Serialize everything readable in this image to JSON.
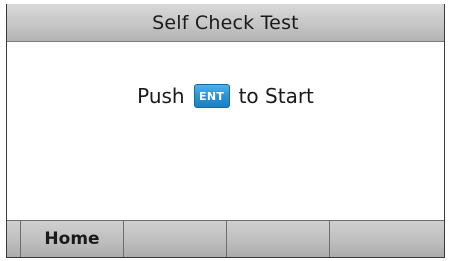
{
  "screen": {
    "title": "Self Check Test"
  },
  "message": {
    "before": "Push",
    "key_label": "ENT",
    "after": "to Start",
    "key_color": "#2a93d5"
  },
  "softkeys": [
    {
      "label": "Home"
    },
    {
      "label": ""
    },
    {
      "label": ""
    },
    {
      "label": ""
    }
  ]
}
